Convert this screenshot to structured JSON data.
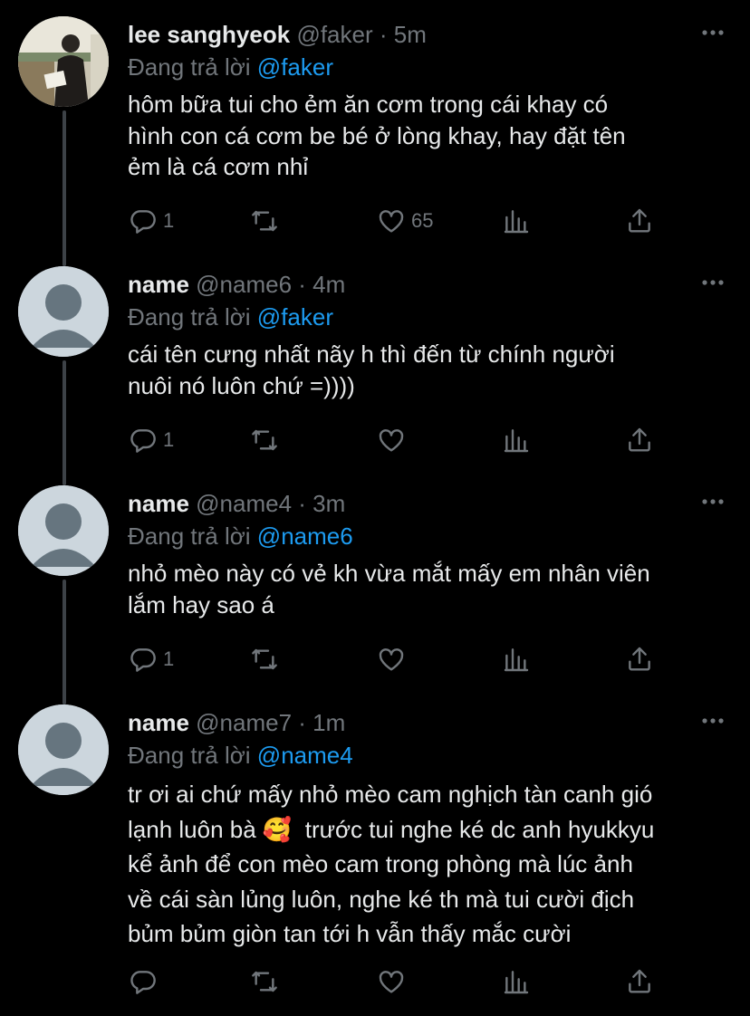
{
  "tweets": [
    {
      "name": "lee sanghyeok",
      "handle": "@faker",
      "time": "· 5m",
      "reply_label": "Đang trả lời",
      "reply_handle": "@faker",
      "text": "hôm bữa tui cho ẻm ăn cơm trong cái khay có\nhình con cá cơm be bé ở lòng khay, hay đặt tên\nẻm là cá cơm nhỉ",
      "reply_count": "1",
      "retweet_count": "",
      "like_count": "65",
      "avatar": "photo-avatar"
    },
    {
      "name": "name",
      "handle": "@name6",
      "time": "· 4m",
      "reply_label": "Đang trả lời",
      "reply_handle": "@faker",
      "text": "cái tên cưng nhất nãy h thì đến từ chính người\nnuôi nó luôn chứ =))))",
      "reply_count": "1",
      "retweet_count": "",
      "like_count": "",
      "avatar": "default-avatar"
    },
    {
      "name": "name",
      "handle": "@name4",
      "time": "· 3m",
      "reply_label": "Đang trả lời",
      "reply_handle": "@name6",
      "text": "nhỏ mèo này có vẻ kh vừa mắt mấy em nhân viên\nlắm hay sao á",
      "reply_count": "1",
      "retweet_count": "",
      "like_count": "",
      "avatar": "default-avatar"
    },
    {
      "name": "name",
      "handle": "@name7",
      "time": "· 1m",
      "reply_label": "Đang trả lời",
      "reply_handle": "@name4",
      "text": "tr ơi ai chứ mấy nhỏ mèo cam nghịch tàn canh gió\nlạnh luôn bà 🥰  trước tui nghe ké dc anh hyukkyu\nkể ảnh để con mèo cam trong phòng mà lúc ảnh\nvề cái sàn lủng luôn, nghe ké th mà tui cười địch\nbủm bủm giòn tan tới h vẫn thấy mắc cười",
      "reply_count": "",
      "retweet_count": "",
      "like_count": "",
      "avatar": "default-avatar"
    }
  ],
  "colors": {
    "background": "#000000",
    "text": "#e7e9ea",
    "secondary": "#71767b",
    "link": "#1d9bf0",
    "thread_line": "#3d4247"
  }
}
